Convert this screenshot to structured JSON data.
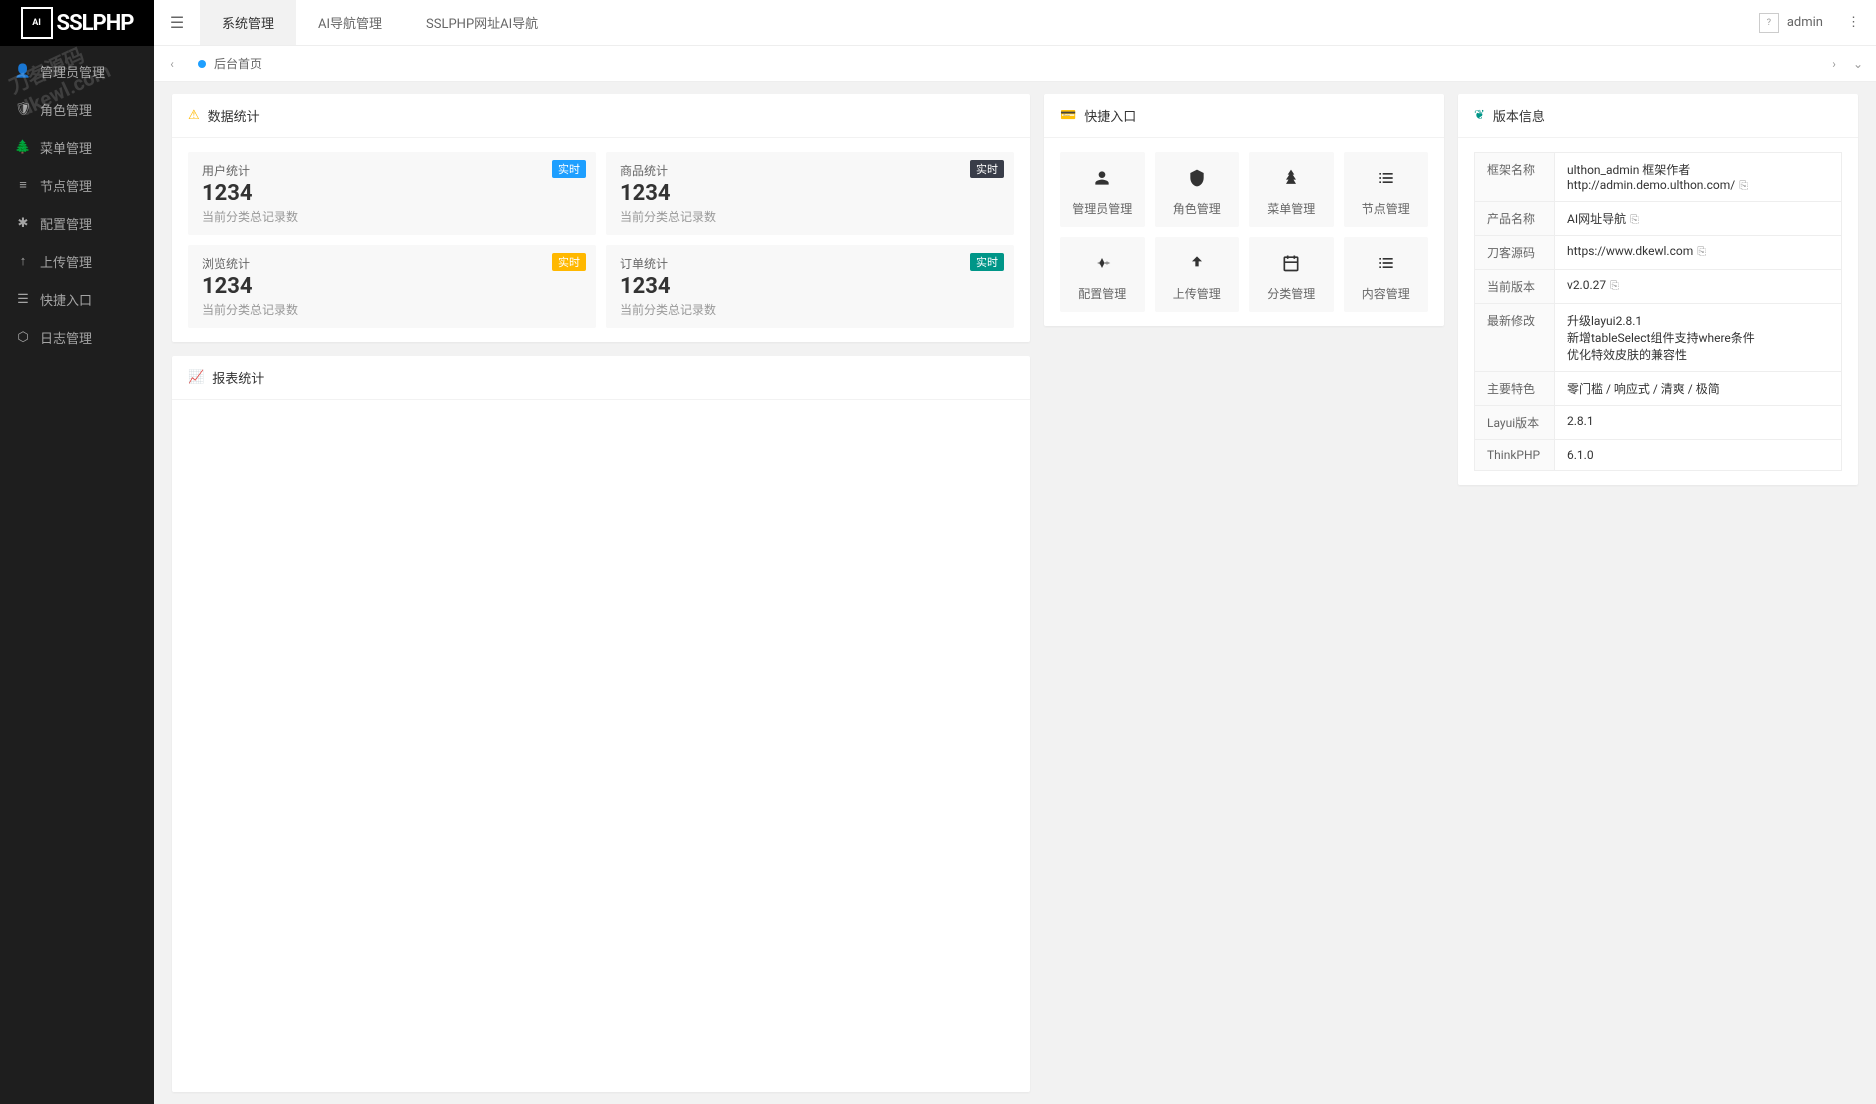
{
  "logo": {
    "prefix": "SSL",
    "suffix": "PHP",
    "icon_text": "AI"
  },
  "watermark": "刀客源码\ndkewl.com",
  "sidebar": {
    "items": [
      {
        "icon": "👤",
        "label": "管理员管理"
      },
      {
        "icon": "🛡",
        "label": "角色管理"
      },
      {
        "icon": "🌲",
        "label": "菜单管理"
      },
      {
        "icon": "≡",
        "label": "节点管理"
      },
      {
        "icon": "✱",
        "label": "配置管理"
      },
      {
        "icon": "↑",
        "label": "上传管理"
      },
      {
        "icon": "☰",
        "label": "快捷入口"
      },
      {
        "icon": "⬡",
        "label": "日志管理"
      }
    ]
  },
  "topnav": {
    "tabs": [
      {
        "label": "系统管理",
        "active": true
      },
      {
        "label": "AI导航管理",
        "active": false
      },
      {
        "label": "SSLPHP网址AI导航",
        "active": false
      }
    ],
    "username": "admin"
  },
  "tabbar": {
    "current": "后台首页"
  },
  "stats": {
    "title": "数据统计",
    "items": [
      {
        "title": "用户统计",
        "value": "1234",
        "sub": "当前分类总记录数",
        "badge": "实时",
        "badge_class": "badge-blue"
      },
      {
        "title": "商品统计",
        "value": "1234",
        "sub": "当前分类总记录数",
        "badge": "实时",
        "badge_class": "badge-dark"
      },
      {
        "title": "浏览统计",
        "value": "1234",
        "sub": "当前分类总记录数",
        "badge": "实时",
        "badge_class": "badge-orange"
      },
      {
        "title": "订单统计",
        "value": "1234",
        "sub": "当前分类总记录数",
        "badge": "实时",
        "badge_class": "badge-green"
      }
    ]
  },
  "quick": {
    "title": "快捷入口",
    "items": [
      {
        "icon": "user-icon",
        "label": "管理员管理"
      },
      {
        "icon": "shield-icon",
        "label": "角色管理"
      },
      {
        "icon": "tree-icon",
        "label": "菜单管理"
      },
      {
        "icon": "list-icon",
        "label": "节点管理"
      },
      {
        "icon": "gear-icon",
        "label": "配置管理"
      },
      {
        "icon": "upload-icon",
        "label": "上传管理"
      },
      {
        "icon": "calendar-icon",
        "label": "分类管理"
      },
      {
        "icon": "content-icon",
        "label": "内容管理"
      }
    ]
  },
  "version": {
    "title": "版本信息",
    "rows": [
      {
        "label": "框架名称",
        "value": "ulthon_admin 框架作者http://admin.demo.ulthon.com/",
        "copy": true
      },
      {
        "label": "产品名称",
        "value": "AI网址导航",
        "copy": true
      },
      {
        "label": "刀客源码",
        "value": "https://www.dkewl.com",
        "copy": true
      },
      {
        "label": "当前版本",
        "value": "v2.0.27",
        "copy": true
      },
      {
        "label": "最新修改",
        "value": "升级layui2.8.1\n新增tableSelect组件支持where条件\n优化特效皮肤的兼容性",
        "copy": false
      },
      {
        "label": "主要特色",
        "value": "零门槛 / 响应式 / 清爽 / 极简",
        "copy": false
      },
      {
        "label": "Layui版本",
        "value": "2.8.1",
        "copy": false
      },
      {
        "label": "ThinkPHP",
        "value": "6.1.0",
        "copy": false
      }
    ]
  },
  "report": {
    "title": "报表统计"
  }
}
